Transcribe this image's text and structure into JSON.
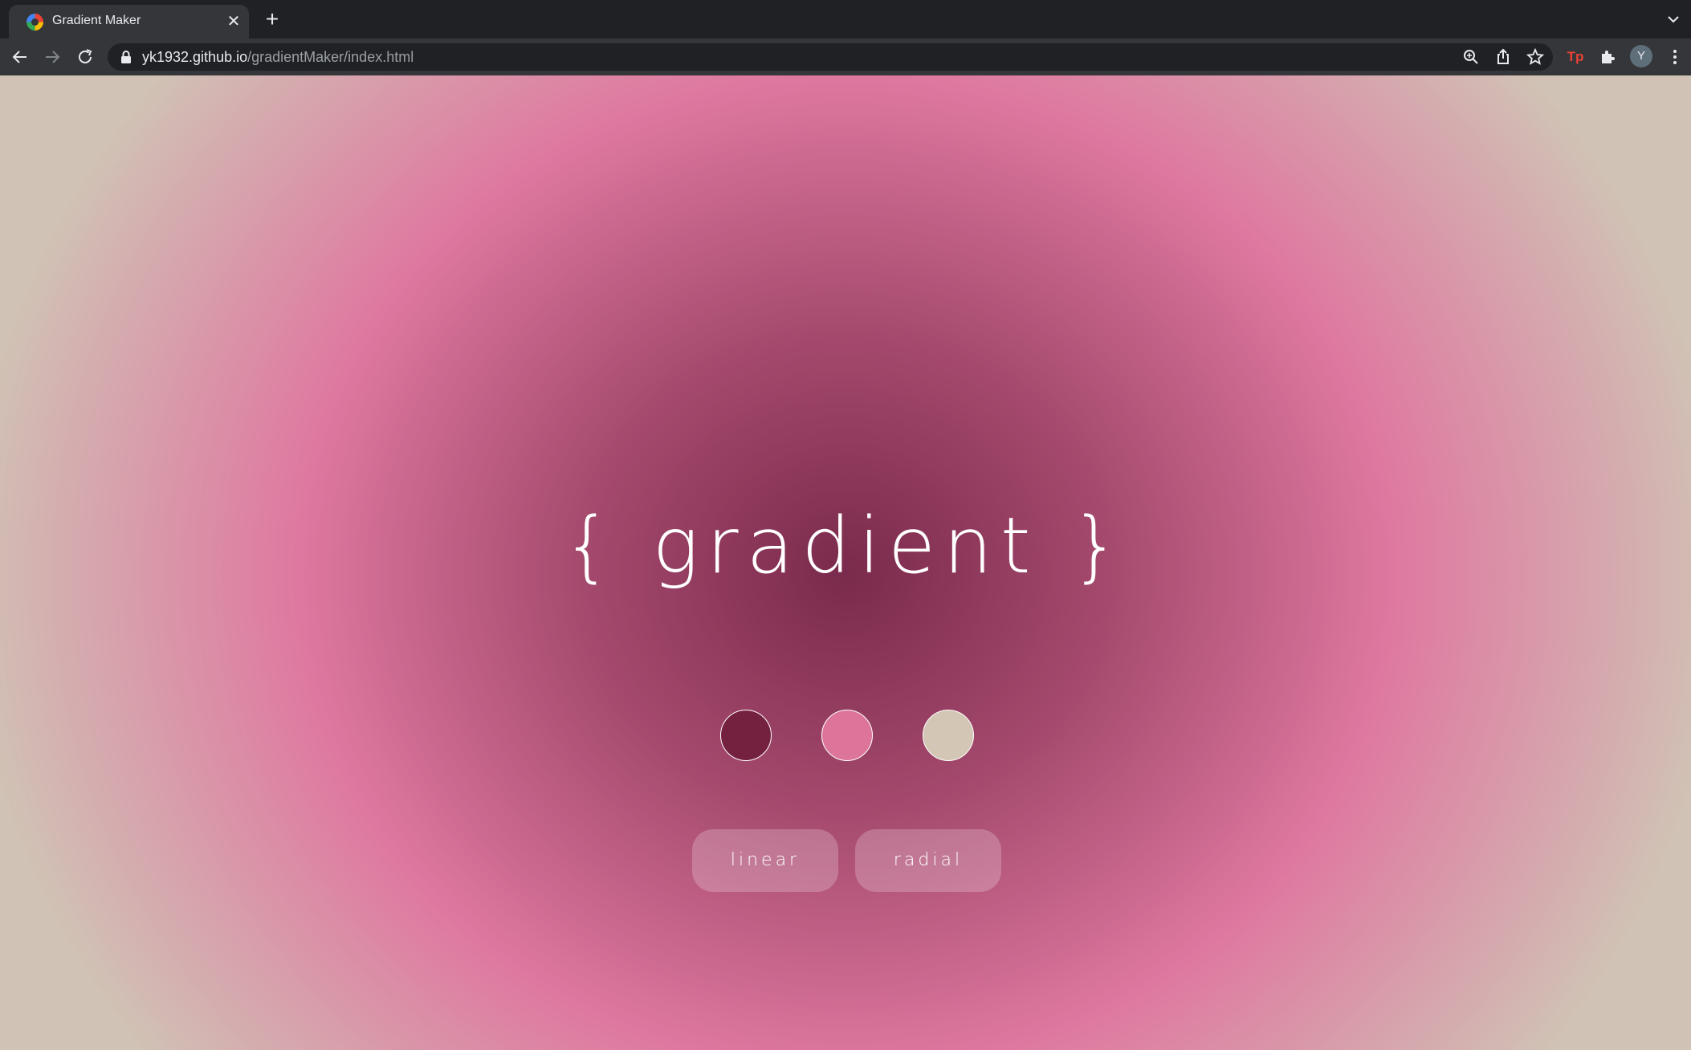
{
  "browser": {
    "tab": {
      "title": "Gradient Maker",
      "favicon": "gradient-maker-favicon"
    },
    "address_bar": {
      "host": "yk1932.github.io",
      "path": "/gradientMaker/index.html"
    },
    "profile_initial": "Y",
    "extension_label": "Tp"
  },
  "page": {
    "title": "{ gradient }",
    "colors": [
      "#74203f",
      "#dc7599",
      "#d3c6b5"
    ],
    "buttons": {
      "linear": "linear",
      "radial": "radial"
    }
  }
}
